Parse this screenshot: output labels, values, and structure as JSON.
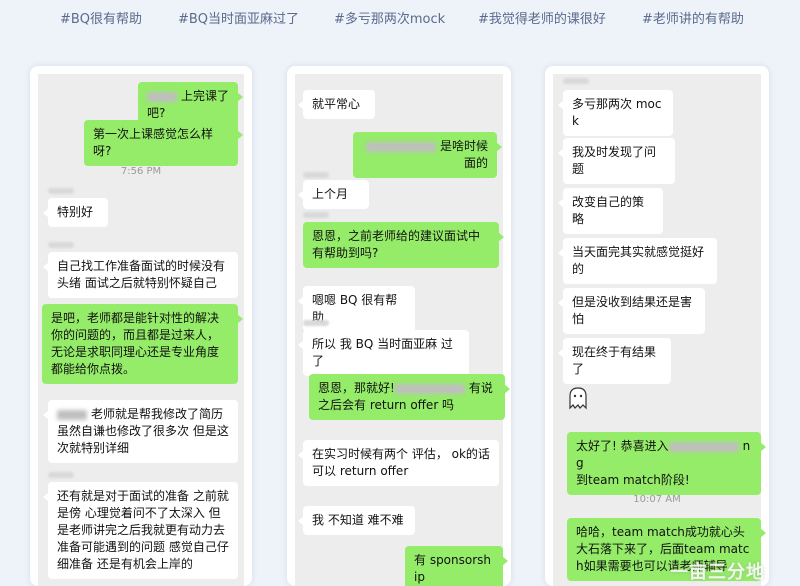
{
  "tags": [
    "#BQ很有帮助",
    "#BQ当时面亚麻过了",
    "#多亏那两次mock",
    "#我觉得老师的课很好",
    "#老师讲的有帮助"
  ],
  "col1": {
    "m1": "上完课了吧?",
    "m2": "第一次上课感觉怎么样呀?",
    "time": "7:56 PM",
    "m3": "特别好",
    "m4": "自己找工作准备面试的时候没有头绪 面试之后就特别怀疑自己",
    "m5": "是吧，老师都是能针对性的解决你的问题的，而且都是过来人，无论是求职同理心还是专业角度都能给你点拨。",
    "m6": "老师就是帮我修改了简历 虽然自谦也修改了很多次 但是这次就特别详细",
    "m7": "还有就是对于面试的准备 之前就是傍 心理觉着问不了太深入 但是老师讲完之后我就更有动力去准备可能遇到的问题 感觉自己仔细准备 还是有机会上岸的"
  },
  "col2": {
    "m1": "就平常心",
    "m2": "是啥时候面的",
    "m3": "上个月",
    "m4": "恩恩，之前老师给的建议面试中有帮助到吗?",
    "m5": "嗯嗯 BQ 很有帮助",
    "m6": "所以 我 BQ 当时面亚麻 过了",
    "m7a": "恩恩，那就好!",
    "m7b": "有说之后会有 return offer 吗",
    "m8": "在实习时候有两个 评估， ok的话可以 return offer",
    "m9": "我 不知道 难不难",
    "m10": "有 sponsorship"
  },
  "col3": {
    "m1": "多亏那两次 mock",
    "m2": "我及时发现了问题",
    "m3": "改变自己的策略",
    "m4": "当天面完其实就感觉挺好的",
    "m5": "但是没收到结果还是害怕",
    "m6": "现在终于有结果了",
    "m7a": "太好了! 恭喜进入",
    "m7b": "ng",
    "m7c": "到team match阶段!",
    "time": "10:07 AM",
    "m8": "哈哈，team match成功就心头大石落下来了，后面team match如果需要也可以请老师辅导"
  },
  "colors": {
    "page_bg": "#eef2f9",
    "bubble_out": "#95ec69",
    "bubble_in": "#ffffff",
    "chat_bg": "#ededed"
  },
  "icons": [
    "ghost-sticker-icon",
    "watermark-logo"
  ]
}
